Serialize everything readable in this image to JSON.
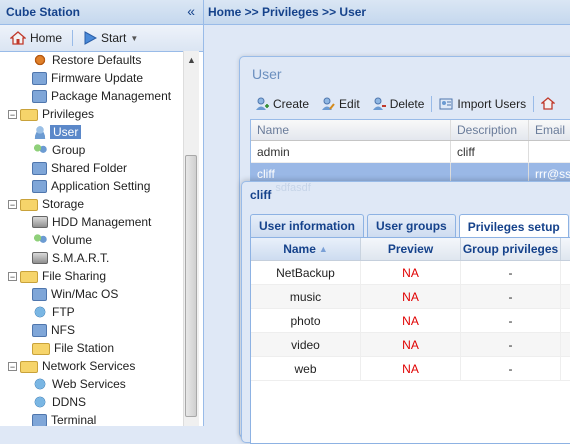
{
  "sidebar": {
    "title": "Cube Station",
    "collapse_icon": "«",
    "toolbar": {
      "home": "Home",
      "start": "Start"
    },
    "tree": [
      {
        "label": "Restore Defaults",
        "type": "leaf",
        "icon": "gear-icon"
      },
      {
        "label": "Firmware Update",
        "type": "leaf",
        "icon": "item-icon"
      },
      {
        "label": "Package Management",
        "type": "leaf",
        "icon": "package-icon"
      },
      {
        "label": "Privileges",
        "type": "folder"
      },
      {
        "label": "User",
        "type": "leaf",
        "icon": "user-icon",
        "selected": true
      },
      {
        "label": "Group",
        "type": "leaf",
        "icon": "group-icon"
      },
      {
        "label": "Shared Folder",
        "type": "leaf",
        "icon": "item-icon"
      },
      {
        "label": "Application Setting",
        "type": "leaf",
        "icon": "item-icon"
      },
      {
        "label": "Storage",
        "type": "folder"
      },
      {
        "label": "HDD Management",
        "type": "leaf",
        "icon": "disk-icon"
      },
      {
        "label": "Volume",
        "type": "leaf",
        "icon": "group-icon"
      },
      {
        "label": "S.M.A.R.T.",
        "type": "leaf",
        "icon": "disk-icon"
      },
      {
        "label": "File Sharing",
        "type": "folder"
      },
      {
        "label": "Win/Mac OS",
        "type": "leaf",
        "icon": "item-icon"
      },
      {
        "label": "FTP",
        "type": "leaf",
        "icon": "globe-icon"
      },
      {
        "label": "NFS",
        "type": "leaf",
        "icon": "item-icon"
      },
      {
        "label": "File Station",
        "type": "leaf",
        "icon": "folder-icon"
      },
      {
        "label": "Network Services",
        "type": "folder"
      },
      {
        "label": "Web Services",
        "type": "leaf",
        "icon": "globe-icon"
      },
      {
        "label": "DDNS",
        "type": "leaf",
        "icon": "globe-icon"
      },
      {
        "label": "Terminal",
        "type": "leaf",
        "icon": "item-icon"
      }
    ]
  },
  "breadcrumb": "Home >> Privileges >> User",
  "user_window": {
    "title": "User",
    "toolbar": {
      "create": "Create",
      "edit": "Edit",
      "delete": "Delete",
      "import": "Import Users"
    },
    "columns": {
      "name": "Name",
      "description": "Description",
      "email": "Email"
    },
    "rows": [
      {
        "name": "admin",
        "description": "cliff",
        "email": ""
      },
      {
        "name": "cliff",
        "description": "",
        "email": "rrr@ss"
      }
    ],
    "ghost_text": "sdfasdf"
  },
  "cliff_window": {
    "title": "cliff",
    "tabs": [
      "User information",
      "User groups",
      "Privileges setup"
    ],
    "columns": {
      "name": "Name",
      "preview": "Preview",
      "group_privileges": "Group privileges"
    },
    "rows": [
      {
        "name": "NetBackup",
        "preview": "NA",
        "group": "-"
      },
      {
        "name": "music",
        "preview": "NA",
        "group": "-"
      },
      {
        "name": "photo",
        "preview": "NA",
        "group": "-"
      },
      {
        "name": "video",
        "preview": "NA",
        "group": "-"
      },
      {
        "name": "web",
        "preview": "NA",
        "group": "-"
      }
    ]
  },
  "colors": {
    "accent": "#15428b",
    "selection": "#5b88c9",
    "na": "#e00000"
  }
}
